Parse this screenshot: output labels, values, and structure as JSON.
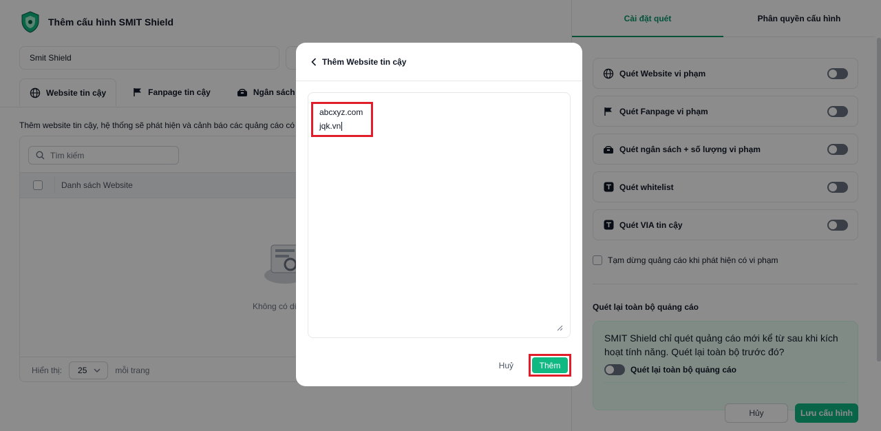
{
  "header": {
    "title": "Thêm cấu hình SMIT Shield"
  },
  "config_name": {
    "value": "Smit Shield"
  },
  "tabs": [
    {
      "label": "Website tin cậy",
      "icon": "globe-icon"
    },
    {
      "label": "Fanpage tin cậy",
      "icon": "flag-icon"
    },
    {
      "label": "Ngân sách",
      "icon": "budget-icon"
    }
  ],
  "description": "Thêm website tin cậy, hệ thống sẽ phát hiện và cảnh báo các quảng cáo có tra",
  "table": {
    "search_placeholder": "Tìm kiếm",
    "column_header": "Danh sách Website",
    "empty_text": "Không có dữ",
    "footer": {
      "display_label": "Hiển thị:",
      "page_size": "25",
      "per_page_label": "mỗi trang"
    }
  },
  "right_tabs": [
    {
      "label": "Cài đặt quét",
      "active": true
    },
    {
      "label": "Phân quyền cấu hình",
      "active": false
    }
  ],
  "scan_rules": [
    {
      "label": "Quét Website vi phạm",
      "icon": "globe-icon",
      "enabled": false
    },
    {
      "label": "Quét Fanpage vi phạm",
      "icon": "flag-icon",
      "enabled": false
    },
    {
      "label": "Quét ngân sách + số lượng vi phạm",
      "icon": "budget-icon",
      "enabled": false
    },
    {
      "label": "Quét whitelist",
      "icon": "whitelist-icon",
      "enabled": false
    },
    {
      "label": "Quét VIA tin cậy",
      "icon": "via-icon",
      "enabled": false
    }
  ],
  "pause_ads": {
    "label": "Tạm dừng quảng cáo khi phát hiện có vi phạm",
    "checked": false
  },
  "rescan": {
    "title": "Quét lại toàn bộ quảng cáo",
    "text": "SMIT Shield chỉ quét quảng cáo mới kể từ sau khi kích hoạt tính năng. Quét lại toàn bộ trước đó?",
    "toggle_label": "Quét lại toàn bộ quảng cáo",
    "enabled": false
  },
  "bottom_actions": {
    "cancel_label": "Hủy",
    "save_label": "Lưu cấu hình"
  },
  "modal": {
    "title": "Thêm Website tin cậy",
    "lines": [
      "abcxyz.com",
      "jqk.vn"
    ],
    "cancel_label": "Huỷ",
    "submit_label": "Thêm"
  },
  "colors": {
    "accent": "#10b981",
    "accent_dark": "#059669",
    "highlight": "#e11d2a"
  }
}
